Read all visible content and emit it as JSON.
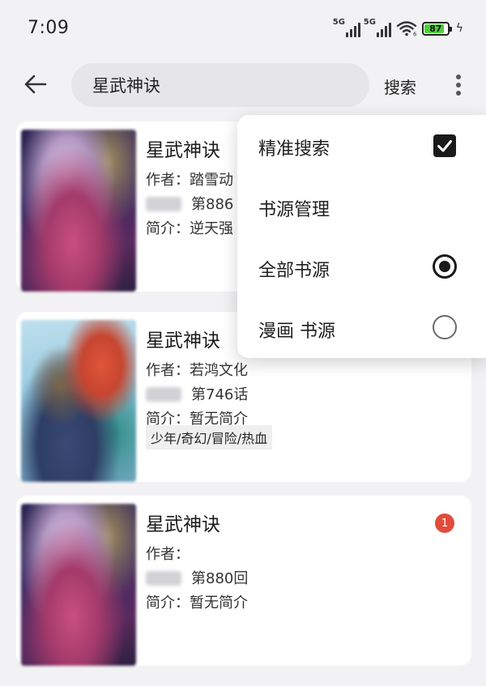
{
  "status_bar": {
    "time": "7:09",
    "net1": "5G",
    "net2": "5G",
    "wifi_sub": "6",
    "battery": "87",
    "battery_fraction": 0.87,
    "battery_color": "#4cd137"
  },
  "top_bar": {
    "query": "星武神诀",
    "search_label": "搜索"
  },
  "results": [
    {
      "title": "星武神诀",
      "author": "作者：踏雪动",
      "latest": "第886",
      "intro": "简介：逆天强"
    },
    {
      "title": "星武神诀",
      "author": "作者：若鸿文化",
      "latest": "第746话",
      "intro": "简介：暂无简介",
      "tags": "少年/奇幻/冒险/热血"
    },
    {
      "title": "星武神诀",
      "author": "作者：",
      "latest": "第880回",
      "intro": "简介：暂无简介",
      "badge": "1"
    }
  ],
  "menu": {
    "items": [
      {
        "label": "精准搜索",
        "control": "checkbox",
        "checked": true
      },
      {
        "label": "书源管理"
      },
      {
        "label": "全部书源",
        "control": "radio",
        "checked": true
      },
      {
        "label": "漫画 书源",
        "control": "radio",
        "checked": false
      }
    ]
  },
  "icons": {
    "back": "arrow-left-icon",
    "more": "more-vertical-icon",
    "check": "check-icon",
    "wifi": "wifi-icon",
    "signal": "signal-icon",
    "battery": "battery-icon",
    "charging": "bolt-icon"
  },
  "colors": {
    "background": "#f2f2f4",
    "search_field": "#e6e6e8",
    "badge": "#e04c3c"
  }
}
